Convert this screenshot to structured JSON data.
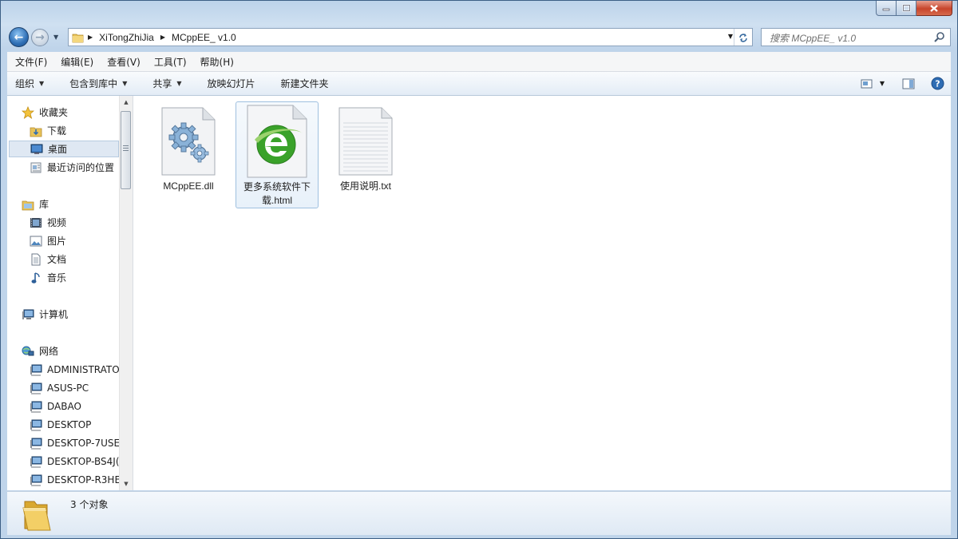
{
  "window": {
    "controls": {
      "minimize_icon": "minimize-icon",
      "maximize_icon": "maximize-icon",
      "close_icon": "close-icon"
    }
  },
  "address": {
    "crumbs": [
      "XiTongZhiJia",
      "MCppEE_ v1.0"
    ],
    "refresh_icon": "refresh-icon"
  },
  "search": {
    "placeholder": "搜索 MCppEE_ v1.0"
  },
  "menu": {
    "items": [
      "文件(F)",
      "编辑(E)",
      "查看(V)",
      "工具(T)",
      "帮助(H)"
    ]
  },
  "commands": {
    "items": [
      {
        "label": "组织",
        "dropdown": true
      },
      {
        "label": "包含到库中",
        "dropdown": true
      },
      {
        "label": "共享",
        "dropdown": true
      },
      {
        "label": "放映幻灯片",
        "dropdown": false
      },
      {
        "label": "新建文件夹",
        "dropdown": false
      }
    ]
  },
  "nav": {
    "items": [
      {
        "label": "收藏夹",
        "icon": "star-icon",
        "level": 0
      },
      {
        "label": "下载",
        "icon": "downloads-folder-icon",
        "level": 1
      },
      {
        "label": "桌面",
        "icon": "desktop-icon",
        "level": 1,
        "selected": true
      },
      {
        "label": "最近访问的位置",
        "icon": "recent-places-icon",
        "level": 1
      },
      {
        "label": "库",
        "icon": "libraries-icon",
        "level": 0
      },
      {
        "label": "视频",
        "icon": "video-icon",
        "level": 1
      },
      {
        "label": "图片",
        "icon": "pictures-icon",
        "level": 1
      },
      {
        "label": "文档",
        "icon": "documents-icon",
        "level": 1
      },
      {
        "label": "音乐",
        "icon": "music-icon",
        "level": 1
      },
      {
        "label": "计算机",
        "icon": "computer-icon",
        "level": 0
      },
      {
        "label": "网络",
        "icon": "network-icon",
        "level": 0
      },
      {
        "label": "ADMINISTRATO",
        "icon": "network-computer-icon",
        "level": 1
      },
      {
        "label": "ASUS-PC",
        "icon": "network-computer-icon",
        "level": 1
      },
      {
        "label": "DABAO",
        "icon": "network-computer-icon",
        "level": 1
      },
      {
        "label": "DESKTOP",
        "icon": "network-computer-icon",
        "level": 1
      },
      {
        "label": "DESKTOP-7USE",
        "icon": "network-computer-icon",
        "level": 1
      },
      {
        "label": "DESKTOP-BS4J(",
        "icon": "network-computer-icon",
        "level": 1
      },
      {
        "label": "DESKTOP-R3HE",
        "icon": "network-computer-icon",
        "level": 1
      }
    ]
  },
  "files": [
    {
      "name": "MCppEE.dll",
      "icon": "dll-gears-icon"
    },
    {
      "name": "更多系统软件下载.html",
      "icon": "browser-html-icon",
      "selected": true
    },
    {
      "name": "使用说明.txt",
      "icon": "text-file-icon"
    }
  ],
  "details": {
    "count_text": "3 个对象",
    "icon": "folder-icon"
  },
  "colors": {
    "accent": "#3a7fc4",
    "selection": "#dfe8f3",
    "browser_green": "#3aa22a"
  }
}
